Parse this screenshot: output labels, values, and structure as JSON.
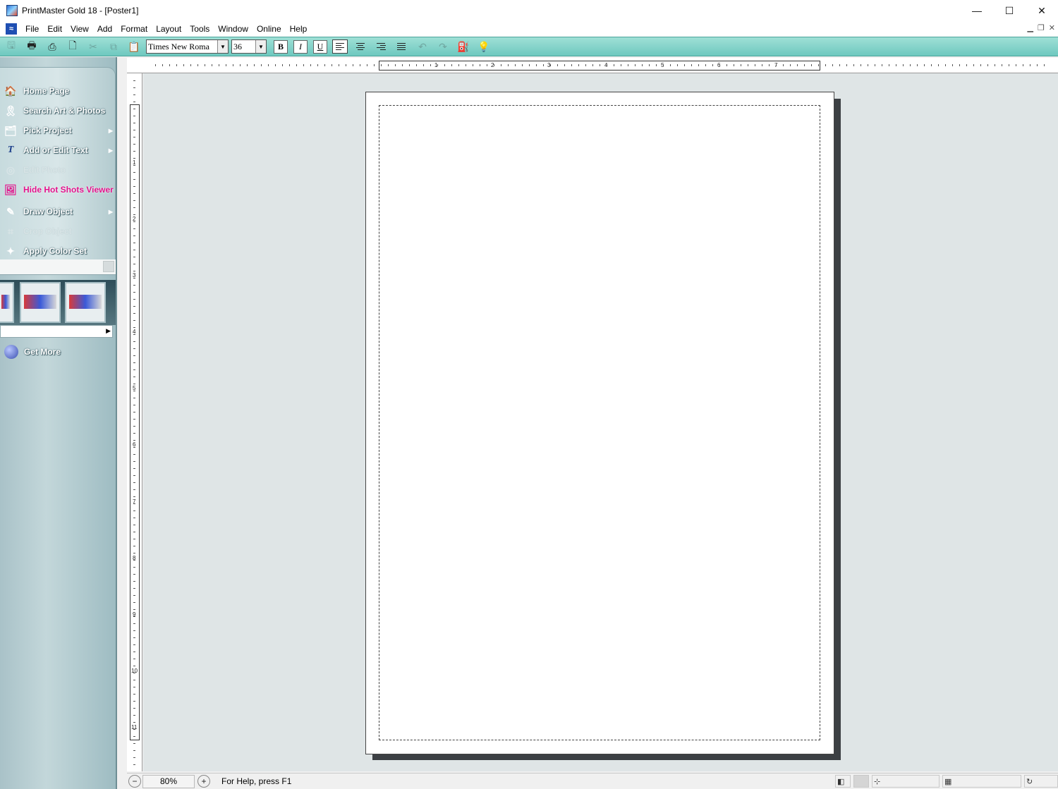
{
  "window": {
    "title": "PrintMaster Gold 18 - [Poster1]",
    "controls": [
      "—",
      "☐",
      "✕"
    ]
  },
  "menu": [
    "File",
    "Edit",
    "View",
    "Add",
    "Format",
    "Layout",
    "Tools",
    "Window",
    "Online",
    "Help"
  ],
  "toolbar": {
    "font_name": "Times New Roma",
    "font_size": "36",
    "bold": "B",
    "italic": "I",
    "underline": "U",
    "active_alignment": "left"
  },
  "sidebar": {
    "items": [
      {
        "label": "Home Page",
        "icon": "home-icon",
        "enabled": true
      },
      {
        "label": "Search Art & Photos",
        "icon": "search-art-icon",
        "enabled": true
      },
      {
        "label": "Pick Project",
        "icon": "pick-project-icon",
        "enabled": true,
        "submenu": true
      },
      {
        "label": "Add or Edit Text",
        "icon": "text-icon",
        "enabled": true,
        "submenu": true
      },
      {
        "label": "Edit Photo",
        "icon": "edit-photo-icon",
        "enabled": false
      },
      {
        "label": "Hide Hot Shots Viewer",
        "icon": "hot-shots-icon",
        "enabled": true,
        "highlight": true
      },
      {
        "label": "Draw Object",
        "icon": "draw-icon",
        "enabled": true,
        "submenu": true
      },
      {
        "label": "Crop Object",
        "icon": "crop-icon",
        "enabled": false
      },
      {
        "label": "Apply Color Set",
        "icon": "color-set-icon",
        "enabled": true
      }
    ],
    "get_more": "Get More"
  },
  "ruler": {
    "h_labels": [
      "1",
      "2",
      "3",
      "4",
      "5",
      "6",
      "7"
    ],
    "v_labels": [
      "1",
      "2",
      "3",
      "4",
      "5",
      "6",
      "7",
      "8",
      "9",
      "10",
      "11"
    ]
  },
  "status": {
    "zoom": "80%",
    "help_text": "For Help, press F1"
  }
}
